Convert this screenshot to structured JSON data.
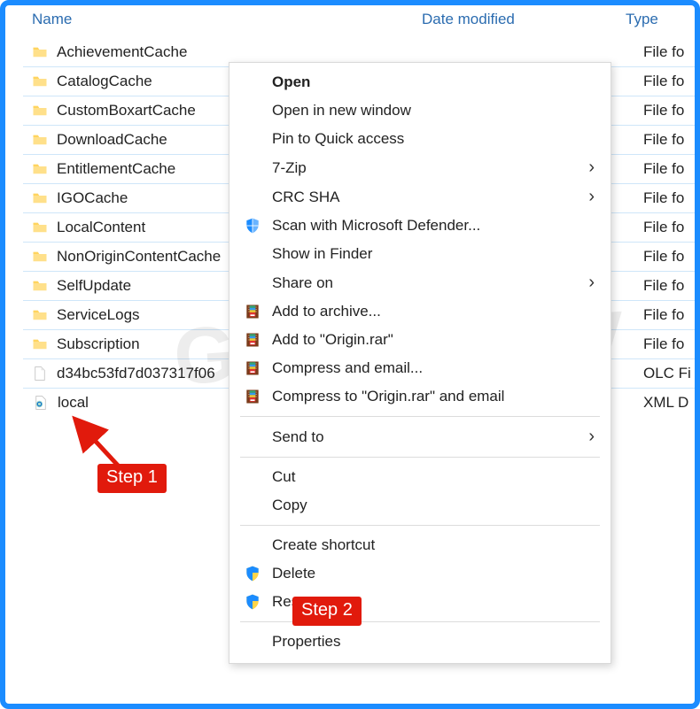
{
  "columns": {
    "name": "Name",
    "date": "Date modified",
    "type": "Type"
  },
  "rows": [
    {
      "name": "AchievementCache",
      "type": "File fo",
      "icon": "folder"
    },
    {
      "name": "CatalogCache",
      "type": "File fo",
      "icon": "folder"
    },
    {
      "name": "CustomBoxartCache",
      "type": "File fo",
      "icon": "folder"
    },
    {
      "name": "DownloadCache",
      "type": "File fo",
      "icon": "folder"
    },
    {
      "name": "EntitlementCache",
      "type": "File fo",
      "icon": "folder"
    },
    {
      "name": "IGOCache",
      "type": "File fo",
      "icon": "folder"
    },
    {
      "name": "LocalContent",
      "type": "File fo",
      "icon": "folder"
    },
    {
      "name": "NonOriginContentCache",
      "type": "File fo",
      "icon": "folder"
    },
    {
      "name": "SelfUpdate",
      "type": "File fo",
      "icon": "folder"
    },
    {
      "name": "ServiceLogs",
      "type": "File fo",
      "icon": "folder"
    },
    {
      "name": "Subscription",
      "type": "File fo",
      "icon": "folder"
    },
    {
      "name": "d34bc53fd7d037317f06",
      "type": "OLC Fi",
      "icon": "file"
    },
    {
      "name": "local",
      "type": "XML D",
      "icon": "xml"
    }
  ],
  "context_menu": {
    "groups": [
      [
        {
          "label": "Open",
          "bold": true,
          "icon": ""
        },
        {
          "label": "Open in new window",
          "icon": ""
        },
        {
          "label": "Pin to Quick access",
          "icon": ""
        },
        {
          "label": "7-Zip",
          "icon": "",
          "submenu": true
        },
        {
          "label": "CRC SHA",
          "icon": "",
          "submenu": true
        },
        {
          "label": "Scan with Microsoft Defender...",
          "icon": "defender"
        },
        {
          "label": "Show in Finder",
          "icon": ""
        },
        {
          "label": "Share on",
          "icon": "",
          "submenu": true
        },
        {
          "label": "Add to archive...",
          "icon": "winrar"
        },
        {
          "label": "Add to \"Origin.rar\"",
          "icon": "winrar"
        },
        {
          "label": "Compress and email...",
          "icon": "winrar"
        },
        {
          "label": "Compress to \"Origin.rar\" and email",
          "icon": "winrar"
        }
      ],
      [
        {
          "label": "Send to",
          "icon": "",
          "submenu": true
        }
      ],
      [
        {
          "label": "Cut",
          "icon": ""
        },
        {
          "label": "Copy",
          "icon": ""
        }
      ],
      [
        {
          "label": "Create shortcut",
          "icon": ""
        },
        {
          "label": "Delete",
          "icon": "shield"
        },
        {
          "label": "Res",
          "icon": "shield"
        }
      ],
      [
        {
          "label": "Properties",
          "icon": ""
        }
      ]
    ]
  },
  "annotations": {
    "step1": "Step 1",
    "step2": "Step 2"
  },
  "watermark": "Gadgetswhy"
}
